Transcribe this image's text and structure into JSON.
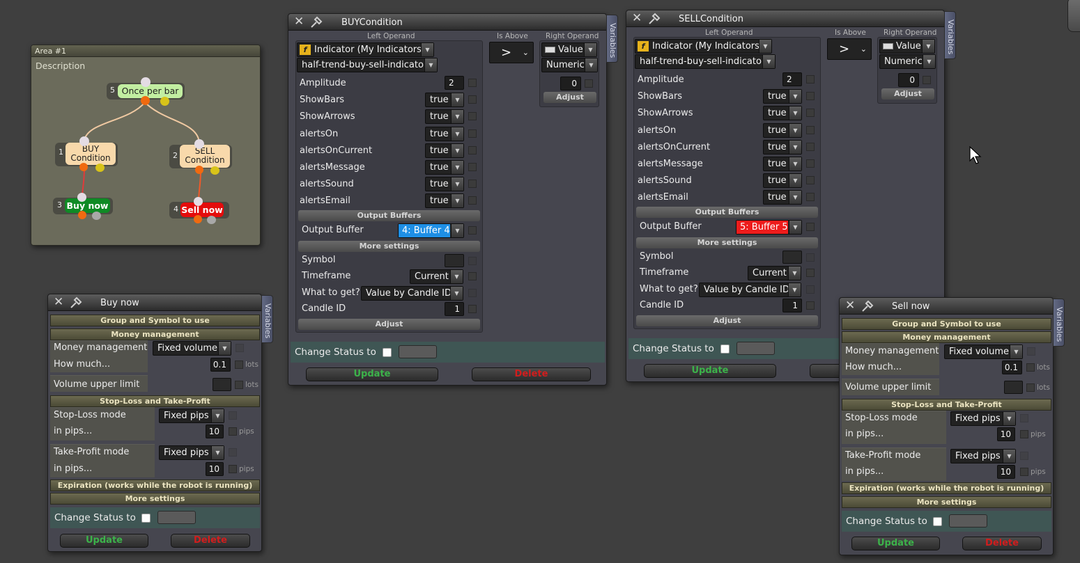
{
  "area": {
    "title": "Area #1",
    "description": "Description",
    "nodes": {
      "once": {
        "num": "5",
        "label": "Once per bar"
      },
      "buy_cond": {
        "num": "1",
        "line1": "BUY",
        "line2": "Condition"
      },
      "sell_cond": {
        "num": "2",
        "line1": "SELL",
        "line2": "Condition"
      },
      "buy_now": {
        "num": "3",
        "label": "Buy now"
      },
      "sell_now": {
        "num": "4",
        "label": "Sell now"
      }
    }
  },
  "buy_condition": {
    "title": "BUYCondition",
    "variables_tab": "Variables",
    "left_operand_label": "Left Operand",
    "is_above_label": "Is Above",
    "right_operand_label": "Right Operand",
    "indicator_select": "Indicator (My Indicators)",
    "indicator_name": "half-trend-buy-sell-indicator",
    "comparator": ">",
    "right_type": "Value",
    "right_kind": "Numeric",
    "right_value": "0",
    "right_adjust": "Adjust",
    "params": [
      {
        "name": "Amplitude",
        "value": "2",
        "kind": "num"
      },
      {
        "name": "ShowBars",
        "value": "true",
        "kind": "dd"
      },
      {
        "name": "ShowArrows",
        "value": "true",
        "kind": "dd"
      },
      {
        "name": "alertsOn",
        "value": "true",
        "kind": "dd"
      },
      {
        "name": "alertsOnCurrent",
        "value": "true",
        "kind": "dd"
      },
      {
        "name": "alertsMessage",
        "value": "true",
        "kind": "dd"
      },
      {
        "name": "alertsSound",
        "value": "true",
        "kind": "dd"
      },
      {
        "name": "alertsEmail",
        "value": "true",
        "kind": "dd"
      }
    ],
    "output_buffers_label": "Output Buffers",
    "output_buffer_label": "Output Buffer",
    "output_buffer_value": "4: Buffer 4",
    "output_buffer_color": "#1e8fe6",
    "more_settings_label": "More settings",
    "symbol_label": "Symbol",
    "timeframe_label": "Timeframe",
    "timeframe_value": "Current",
    "what_label": "What to get?",
    "what_value": "Value by Candle ID",
    "candle_label": "Candle ID",
    "candle_value": "1",
    "adjust_label": "Adjust",
    "change_status_label": "Change Status to",
    "update_label": "Update",
    "delete_label": "Delete"
  },
  "sell_condition": {
    "title": "SELLCondition",
    "variables_tab": "Variables",
    "left_operand_label": "Left Operand",
    "is_above_label": "Is Above",
    "right_operand_label": "Right Operand",
    "indicator_select": "Indicator (My Indicators)",
    "indicator_name": "half-trend-buy-sell-indicator",
    "comparator": ">",
    "right_type": "Value",
    "right_kind": "Numeric",
    "right_value": "0",
    "right_adjust": "Adjust",
    "params": [
      {
        "name": "Amplitude",
        "value": "2",
        "kind": "num"
      },
      {
        "name": "ShowBars",
        "value": "true",
        "kind": "dd"
      },
      {
        "name": "ShowArrows",
        "value": "true",
        "kind": "dd"
      },
      {
        "name": "alertsOn",
        "value": "true",
        "kind": "dd"
      },
      {
        "name": "alertsOnCurrent",
        "value": "true",
        "kind": "dd"
      },
      {
        "name": "alertsMessage",
        "value": "true",
        "kind": "dd"
      },
      {
        "name": "alertsSound",
        "value": "true",
        "kind": "dd"
      },
      {
        "name": "alertsEmail",
        "value": "true",
        "kind": "dd"
      }
    ],
    "output_buffers_label": "Output Buffers",
    "output_buffer_label": "Output Buffer",
    "output_buffer_value": "5: Buffer 5",
    "output_buffer_color": "#ee1c1c",
    "more_settings_label": "More settings",
    "symbol_label": "Symbol",
    "timeframe_label": "Timeframe",
    "timeframe_value": "Current",
    "what_label": "What to get?",
    "what_value": "Value by Candle ID",
    "candle_label": "Candle ID",
    "candle_value": "1",
    "adjust_label": "Adjust",
    "change_status_label": "Change Status to",
    "update_label": "Update"
  },
  "buy_now": {
    "title": "Buy now",
    "variables_tab": "Variables",
    "group_symbol": "Group and Symbol to use",
    "money_management_section": "Money management",
    "money_management_label": "Money management",
    "money_management_value": "Fixed volume",
    "how_much_label": "How much...",
    "how_much_value": "0.1",
    "lots": "lots",
    "volume_upper_label": "Volume upper limit",
    "sl_tp_section": "Stop-Loss and Take-Profit",
    "sl_mode_label": "Stop-Loss mode",
    "sl_mode_value": "Fixed pips",
    "sl_pips_label": "in pips...",
    "sl_pips_value": "10",
    "pips": "pips",
    "tp_mode_label": "Take-Profit mode",
    "tp_mode_value": "Fixed pips",
    "tp_pips_label": "in pips...",
    "tp_pips_value": "10",
    "expiration": "Expiration (works while the robot is running)",
    "more_settings": "More settings",
    "change_status_label": "Change Status to",
    "update_label": "Update",
    "delete_label": "Delete"
  },
  "sell_now": {
    "title": "Sell now",
    "variables_tab": "Variables",
    "group_symbol": "Group and Symbol to use",
    "money_management_section": "Money management",
    "money_management_label": "Money management",
    "money_management_value": "Fixed volume",
    "how_much_label": "How much...",
    "how_much_value": "0.1",
    "lots": "lots",
    "volume_upper_label": "Volume upper limit",
    "sl_tp_section": "Stop-Loss and Take-Profit",
    "sl_mode_label": "Stop-Loss mode",
    "sl_mode_value": "Fixed pips",
    "sl_pips_label": "in pips...",
    "sl_pips_value": "10",
    "pips": "pips",
    "tp_mode_label": "Take-Profit mode",
    "tp_mode_value": "Fixed pips",
    "tp_pips_label": "in pips...",
    "tp_pips_value": "10",
    "expiration": "Expiration (works while the robot is running)",
    "more_settings": "More settings",
    "change_status_label": "Change Status to",
    "update_label": "Update",
    "delete_label": "Delete"
  }
}
